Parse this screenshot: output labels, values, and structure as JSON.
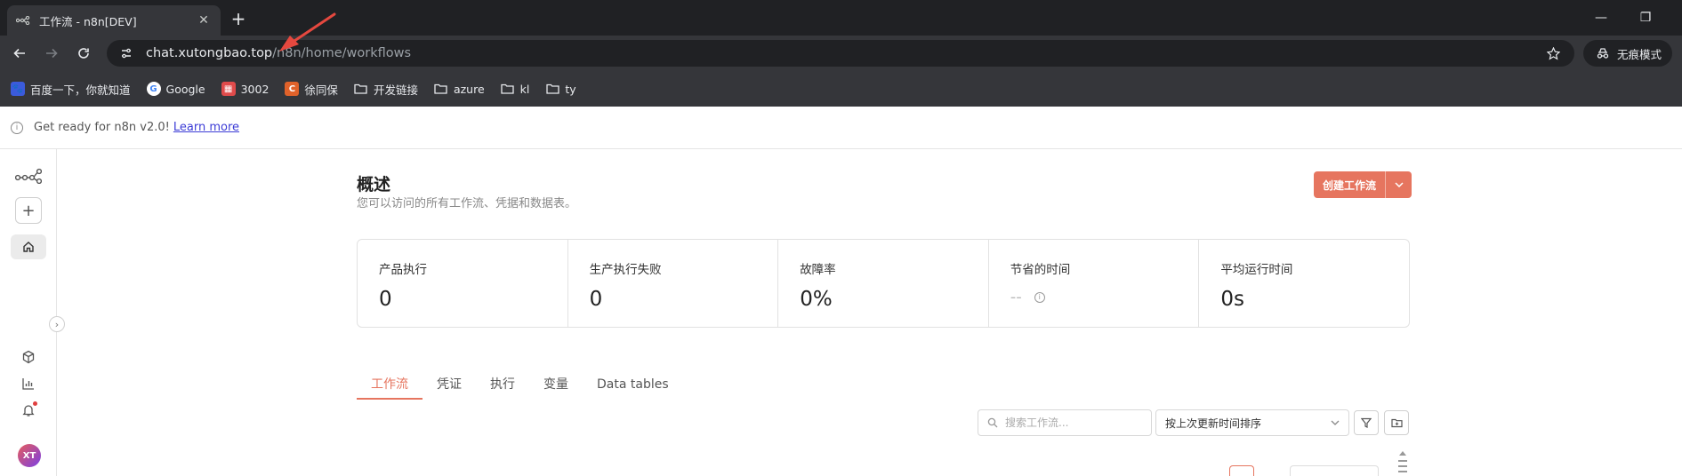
{
  "browser": {
    "tab_title": "工作流 - n8n[DEV]",
    "url_host": "chat.xutongbao.top",
    "url_path": "/n8n/home/workflows",
    "incognito_label": "无痕模式",
    "bookmarks": [
      {
        "label": "百度一下，你就知道",
        "icon": "baidu-icon",
        "color": "#3b5bdb"
      },
      {
        "label": "Google",
        "icon": "google-icon",
        "color": "#ffffff"
      },
      {
        "label": "3002",
        "icon": "app-icon",
        "color": "#e04b4b"
      },
      {
        "label": "徐同保",
        "icon": "c-icon",
        "color": "#e0622a"
      },
      {
        "label": "开发链接",
        "icon": "folder-icon",
        "color": ""
      },
      {
        "label": "azure",
        "icon": "folder-icon",
        "color": ""
      },
      {
        "label": "kl",
        "icon": "folder-icon",
        "color": ""
      },
      {
        "label": "ty",
        "icon": "folder-icon",
        "color": ""
      }
    ]
  },
  "banner": {
    "text": "Get ready for n8n v2.0!",
    "link": "Learn more"
  },
  "sidebar": {
    "avatar_initials": "XT"
  },
  "header": {
    "title": "概述",
    "subtitle": "您可以访问的所有工作流、凭据和数据表。",
    "create_button": "创建工作流"
  },
  "stats": [
    {
      "label": "产品执行",
      "value": "0"
    },
    {
      "label": "生产执行失败",
      "value": "0"
    },
    {
      "label": "故障率",
      "value": "0%"
    },
    {
      "label": "节省的时间",
      "value": "--"
    },
    {
      "label": "平均运行时间",
      "value": "0s"
    }
  ],
  "tabs": [
    {
      "label": "工作流",
      "active": true
    },
    {
      "label": "凭证",
      "active": false
    },
    {
      "label": "执行",
      "active": false
    },
    {
      "label": "变量",
      "active": false
    },
    {
      "label": "Data tables",
      "active": false
    }
  ],
  "filters": {
    "search_placeholder": "搜索工作流...",
    "sort_label": "按上次更新时间排序"
  },
  "colors": {
    "accent": "#e6755f",
    "chrome_dark": "#202124",
    "chrome_mid": "#35363a",
    "annotation": "#e5483f"
  }
}
